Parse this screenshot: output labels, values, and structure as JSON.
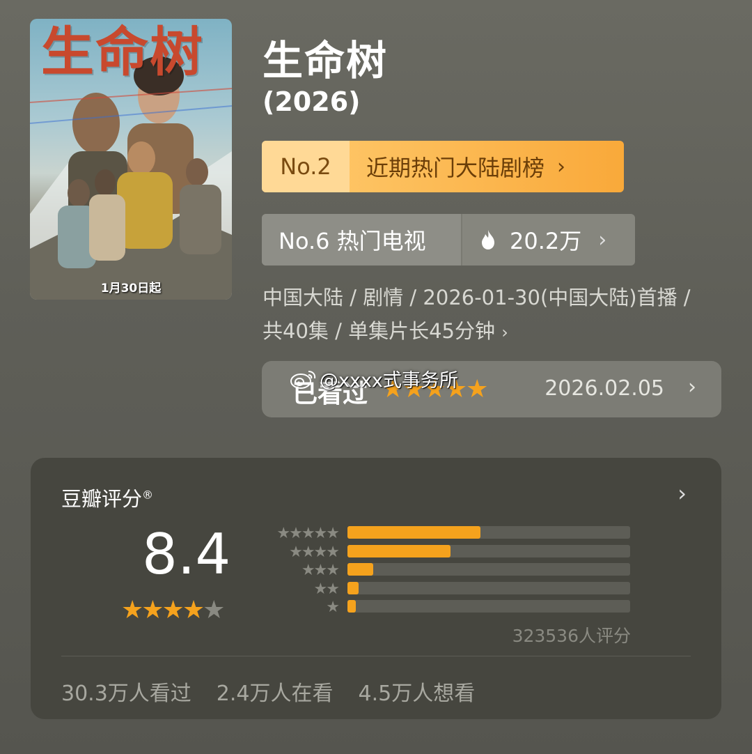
{
  "poster": {
    "title_art": "生命树",
    "date_text": "1月30日起"
  },
  "show": {
    "title": "生命树",
    "year": "(2026)"
  },
  "rank_primary": {
    "num": "No.2",
    "label": "近期热门大陆剧榜",
    "chevron": "›"
  },
  "rank_secondary": {
    "left": "No.6 热门电视",
    "hot": "20.2万",
    "icon": "flame-icon",
    "chevron": "›"
  },
  "meta": {
    "line1": "中国大陆 / 剧情 / 2026-01-30(中国大陆)首播 /",
    "line2": "共40集 / 单集片长45分钟",
    "chevron": "›"
  },
  "watched": {
    "label": "已看过",
    "stars": "★★★★★",
    "date": "2026.02.05",
    "chevron": "›"
  },
  "watermark": {
    "text": "@xxxx式事务所",
    "icon": "weibo-icon"
  },
  "rating": {
    "title": "豆瓣评分",
    "reg_mark": "®",
    "chevron": "›",
    "score": "8.4",
    "stars_on": "★★★★",
    "stars_off": "★",
    "distribution": [
      {
        "stars": "★★★★★",
        "fraction": 0.47
      },
      {
        "stars": "★★★★",
        "fraction": 0.365
      },
      {
        "stars": "★★★",
        "fraction": 0.09
      },
      {
        "stars": "★★",
        "fraction": 0.04
      },
      {
        "stars": "★",
        "fraction": 0.03
      }
    ],
    "count": "323536人评分",
    "stats": [
      "30.3万人看过",
      "2.4万人在看",
      "4.5万人想看"
    ]
  },
  "colors": {
    "accent": "#f5a21d",
    "rank_bg": "#ffcc70"
  }
}
